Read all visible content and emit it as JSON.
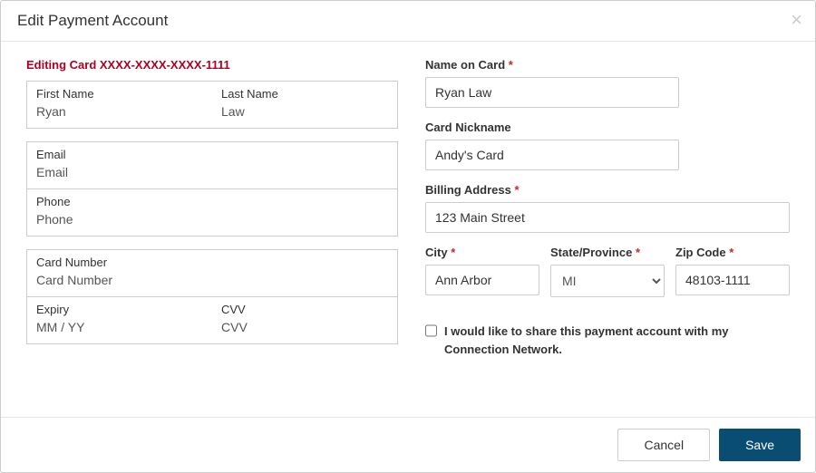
{
  "modal": {
    "title": "Edit Payment Account",
    "close_symbol": "×"
  },
  "editing_notice": "Editing Card XXXX-XXXX-XXXX-1111",
  "left": {
    "first_name": {
      "label": "First Name",
      "value": "Ryan"
    },
    "last_name": {
      "label": "Last Name",
      "value": "Law"
    },
    "email": {
      "label": "Email",
      "placeholder": "Email",
      "value": ""
    },
    "phone": {
      "label": "Phone",
      "placeholder": "Phone",
      "value": ""
    },
    "card_number": {
      "label": "Card Number",
      "placeholder": "Card Number",
      "value": ""
    },
    "expiry": {
      "label": "Expiry",
      "placeholder": "MM / YY",
      "value": ""
    },
    "cvv": {
      "label": "CVV",
      "placeholder": "CVV",
      "value": ""
    }
  },
  "right": {
    "name_on_card": {
      "label": "Name on Card",
      "required": "*",
      "value": "Ryan Law"
    },
    "card_nickname": {
      "label": "Card Nickname",
      "value": "Andy's Card"
    },
    "billing_address": {
      "label": "Billing Address",
      "required": "*",
      "value": "123 Main Street"
    },
    "city": {
      "label": "City",
      "required": "*",
      "value": "Ann Arbor"
    },
    "state": {
      "label": "State/Province",
      "required": "*",
      "value": "MI"
    },
    "zip": {
      "label": "Zip Code",
      "required": "*",
      "value": "48103-1111"
    },
    "share_checkbox": {
      "label": "I would like to share this payment account with my Connection Network.",
      "checked": false
    }
  },
  "footer": {
    "cancel": "Cancel",
    "save": "Save"
  }
}
